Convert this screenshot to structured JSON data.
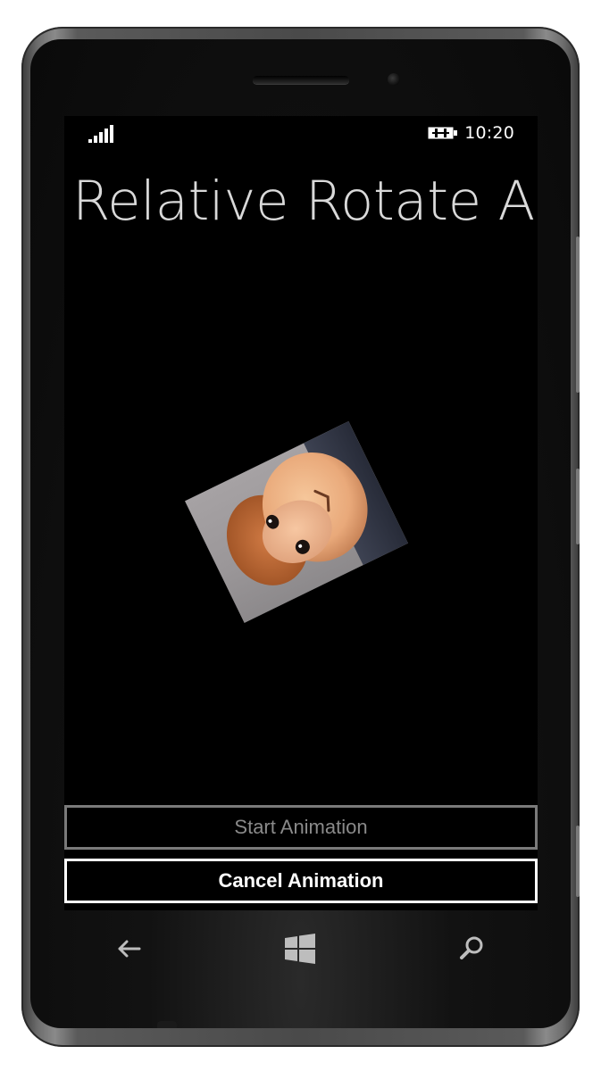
{
  "status_bar": {
    "signal_icon": "signal-strength-icon",
    "battery_icon": "battery-charging-icon",
    "time": "10:20"
  },
  "app": {
    "title": "Relative Rotate A",
    "image_subject": "stuffed-monkey-photo",
    "rotation_deg": -26
  },
  "buttons": {
    "start_label": "Start Animation",
    "cancel_label": "Cancel Animation"
  },
  "nav": {
    "back_icon": "back-arrow-icon",
    "home_icon": "windows-logo-icon",
    "search_icon": "search-icon"
  },
  "colors": {
    "screen_bg": "#000000",
    "title": "#d9d9d9",
    "disabled_button": "#7a7a7a",
    "active_button": "#ffffff"
  }
}
